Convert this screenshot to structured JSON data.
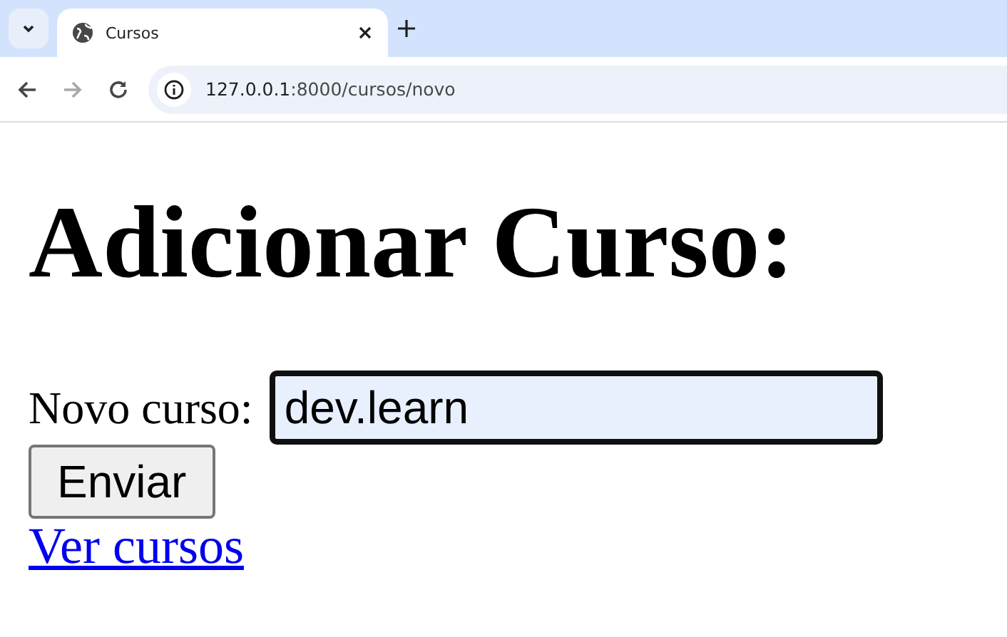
{
  "browser": {
    "tab": {
      "title": "Cursos",
      "selected": true
    },
    "url": {
      "host": "127.0.0.1",
      "path": ":8000/cursos/novo"
    }
  },
  "page": {
    "heading": "Adicionar Curso:",
    "field": {
      "label": "Novo curso:",
      "value": "dev.learn",
      "focused": true
    },
    "button": "Enviar",
    "link": "Ver cursos"
  }
}
